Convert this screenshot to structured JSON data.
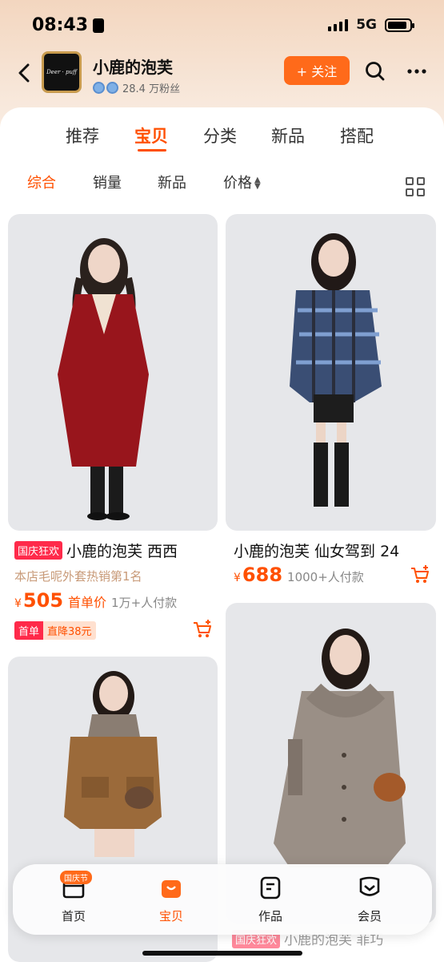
{
  "status_bar": {
    "time": "08:43",
    "network": "5G"
  },
  "shop": {
    "name": "小鹿的泡芙",
    "fans": "28.4 万粉丝",
    "follow_label": "+ 关注",
    "logo_text": "Deer · puff"
  },
  "tabs": [
    {
      "label": "推荐"
    },
    {
      "label": "宝贝"
    },
    {
      "label": "分类"
    },
    {
      "label": "新品"
    },
    {
      "label": "搭配"
    }
  ],
  "sort": [
    {
      "label": "综合"
    },
    {
      "label": "销量"
    },
    {
      "label": "新品"
    },
    {
      "label": "价格"
    }
  ],
  "products": [
    {
      "tag": "国庆狂欢",
      "title": "小鹿的泡芙 西西",
      "subtitle": "本店毛呢外套热销第1名",
      "currency": "¥",
      "price": "505",
      "promo": "首单价",
      "paid": "1万+人付款",
      "badge_a": "首单",
      "badge_b": "直降38元"
    },
    {
      "title": "小鹿的泡芙 仙女驾到 24",
      "currency": "¥",
      "price": "688",
      "paid": "1000+人付款"
    },
    {
      "peek_tag": "国庆狂欢",
      "peek_title": "小鹿的泡芙 菲巧"
    }
  ],
  "bottom_nav": [
    {
      "label": "首页",
      "badge": "国庆节"
    },
    {
      "label": "宝贝"
    },
    {
      "label": "作品"
    },
    {
      "label": "会员"
    }
  ],
  "colors": {
    "accent": "#ff5000",
    "follow": "#ff6a1a"
  }
}
